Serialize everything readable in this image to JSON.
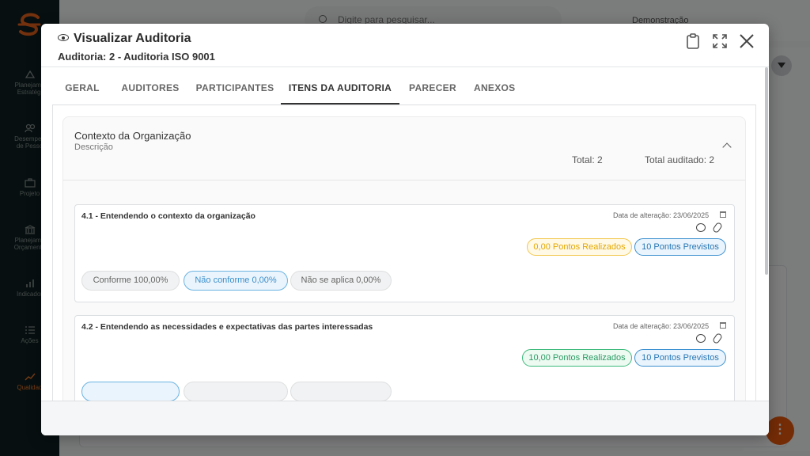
{
  "sidebar": {
    "items": [
      {
        "label": "Planejamento Estratégico",
        "l1": "Planejame",
        "l2": "Estratégi"
      },
      {
        "label": "Desempenho de Pessoas",
        "l1": "Desempen",
        "l2": "de Pesso"
      },
      {
        "label": "Projetos",
        "l1": "Projeto",
        "l2": ""
      },
      {
        "label": "Planejamento Orçamentário",
        "l1": "Planejame",
        "l2": "Orçamenta"
      },
      {
        "label": "Indicadores",
        "l1": "Indicador",
        "l2": ""
      },
      {
        "label": "Ações",
        "l1": "Ações",
        "l2": ""
      },
      {
        "label": "Qualidade",
        "l1": "Qualidad",
        "l2": ""
      }
    ]
  },
  "topbar": {
    "search_placeholder": "Digite para pesquisar...",
    "demo_label": "Demonstração"
  },
  "modal": {
    "title": "Visualizar Auditoria",
    "subtitle": "Auditoria: 2 - Auditoria ISO 9001",
    "tabs": [
      "GERAL",
      "AUDITORES",
      "PARTICIPANTES",
      "ITENS DA AUDITORIA",
      "PARECER",
      "ANEXOS"
    ],
    "active_tab": "ITENS DA AUDITORIA",
    "section": {
      "title": "Contexto da Organização",
      "description": "Descrição",
      "total": "Total: 2",
      "total_audited": "Total auditado: 2"
    },
    "items": [
      {
        "title": "4.1 - Entendendo o contexto da organização",
        "date": "Data de alteração: 23/06/2025",
        "realized": "0,00 Pontos Realizados",
        "expected": "10 Pontos Previstos",
        "options": [
          "Conforme 100,00%",
          "Não conforme 0,00%",
          "Não se aplica 0,00%"
        ]
      },
      {
        "title": "4.2 - Entendendo as necessidades e expectativas das partes interessadas",
        "date": "Data de alteração: 23/06/2025",
        "realized": "10,00 Pontos Realizados",
        "expected": "10 Pontos Previstos",
        "options": [
          "",
          "",
          ""
        ]
      }
    ]
  },
  "colors": {
    "accent_orange": "#f27a2a",
    "sidebar_bg": "#0e1e20",
    "yellow": "#e4a800",
    "green": "#2a9b62",
    "blue": "#2776b5"
  }
}
